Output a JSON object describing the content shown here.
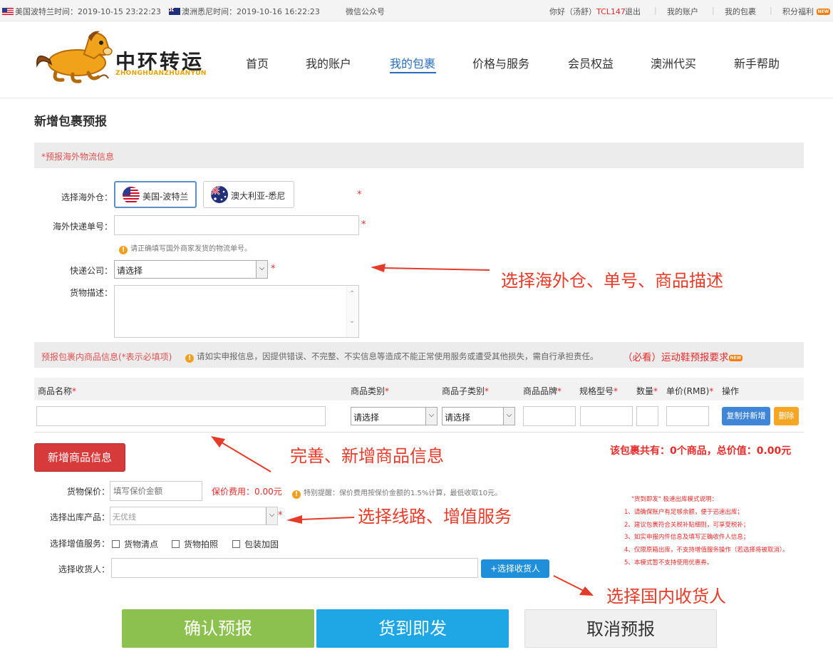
{
  "topbar": {
    "us_time": "美国波特兰时间：2019-10-15 23:22:23",
    "au_time": "澳洲悉尼时间：2019-10-16 16:22:23",
    "wechat": "微信公众号",
    "greeting": "你好（汤舒）",
    "user_id": "TCL147",
    "logout": "退出",
    "my_account": "我的账户",
    "my_package": "我的包裹",
    "points": "积分福利",
    "new_badge": "NEW"
  },
  "header": {
    "logo_title": "中环转运",
    "logo_sub": "ZHONGHUANZHUANYUN",
    "nav": [
      "首页",
      "我的账户",
      "我的包裹",
      "价格与服务",
      "会员权益",
      "澳洲代买",
      "新手帮助"
    ],
    "active_nav": "我的包裹"
  },
  "page_title": "新增包裹预报",
  "section1": {
    "label": "*预报海外物流信息"
  },
  "form1": {
    "warehouse_label": "选择海外仓：",
    "warehouse_options": [
      "美国-波特兰",
      "澳大利亚-悉尼"
    ],
    "selected_warehouse": "美国-波特兰",
    "tracking_label": "海外快递单号：",
    "tracking_value": "",
    "tracking_hint": "请正确填写国外商家发货的物流单号。",
    "courier_label": "快递公司：",
    "courier_value": "请选择",
    "desc_label": "货物描述：",
    "desc_value": "",
    "required_mark": "*"
  },
  "section2": {
    "label": "预报包裹内商品信息(*表示必填项)",
    "warning": "请如实申报信息，因提供错误、不完整、不实信息等造成不能正常使用服务或遭受其他损失，需自行承担责任。",
    "link": "（必看）运动鞋预报要求",
    "new_badge": "NEW"
  },
  "product_table": {
    "headers": [
      "商品名称",
      "商品类别",
      "商品子类别",
      "商品品牌",
      "规格型号",
      "数量",
      "单价(RMB)",
      "操作"
    ],
    "category_value": "请选择",
    "subcategory_value": "请选择",
    "copy_button": "复制并新增",
    "delete_button": "删除"
  },
  "add_product_button": "新增商品信息",
  "summary": "该包裹共有：0个商品，总价值：0.00元",
  "form2": {
    "insurance_label": "货物保价：",
    "insurance_placeholder": "填写保价金额",
    "insurance_fee": "保价费用：0.00元",
    "insurance_hint": "特别提醒：保价费用按保价金额的1.5%计算，最低收取10元。",
    "product_label": "选择出库产品：",
    "product_value": "无优线",
    "services_label": "选择增值服务：",
    "services": [
      "货物清点",
      "货物拍照",
      "包装加固"
    ],
    "receiver_label": "选择收货人：",
    "receiver_value": "",
    "receiver_button": "+选择收货人"
  },
  "notes": {
    "title": "\"货到即发\" 极速出库模式说明：",
    "items": [
      "1、请确保账户有足够余额，便于迅速出库；",
      "2、建议包裹符合关税补贴细则，可享受税补；",
      "3、如实申报内件信息及填写正确收件人信息；",
      "4、仅限原箱出库，不支持增值服务操作（若选择将被取消）。",
      "5、本模式暂不支持使用优惠券。"
    ]
  },
  "buttons": {
    "confirm": "确认预报",
    "ship_on_arrival": "货到即发",
    "cancel": "取消预报"
  },
  "annotations": {
    "a1": "选择海外仓、单号、商品描述",
    "a2": "完善、新增商品信息",
    "a3": "选择线路、增值服务",
    "a4": "选择国内收货人"
  },
  "colors": {
    "accent_blue": "#2a6db8",
    "required_red": "#e52b2b",
    "add_button_red": "#d63a3a",
    "confirm_green": "#8cc04f",
    "ship_blue": "#1ea7e4",
    "cancel_gray": "#f0f0f0"
  }
}
